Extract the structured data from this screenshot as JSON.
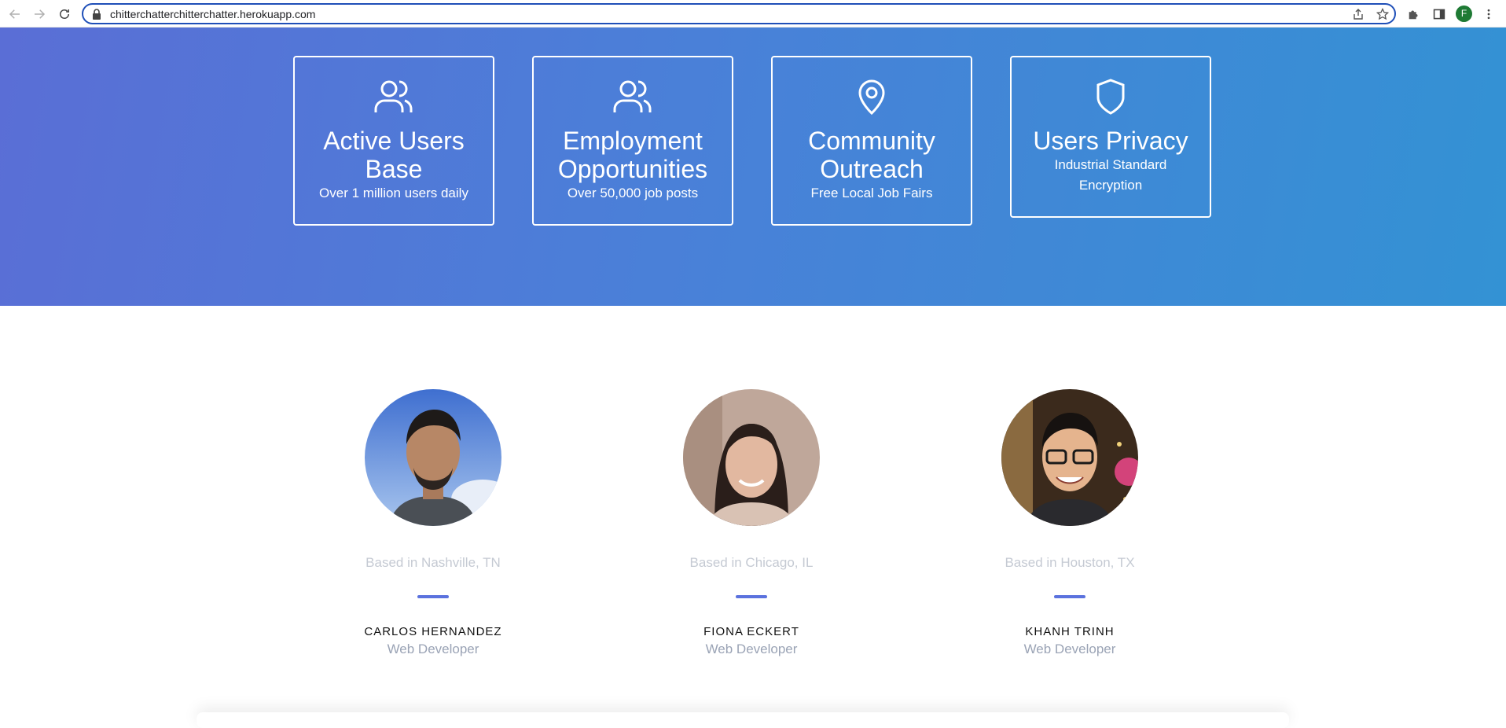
{
  "browser": {
    "url": "chitterchatterchitterchatter.herokuapp.com",
    "profile_initial": "F"
  },
  "features": [
    {
      "icon": "users-icon",
      "title": "Active Users Base",
      "subtitle": "Over 1 million users daily"
    },
    {
      "icon": "users-icon",
      "title": "Employment Opportunities",
      "subtitle": "Over 50,000 job posts"
    },
    {
      "icon": "map-pin-icon",
      "title": "Community Outreach",
      "subtitle": "Free Local Job Fairs"
    },
    {
      "icon": "shield-icon",
      "title": "Users Privacy",
      "subtitle": "Industrial Standard Encryption"
    }
  ],
  "team": [
    {
      "location": "Based in Nashville, TN",
      "name": "CARLOS HERNANDEZ",
      "role": "Web Developer"
    },
    {
      "location": "Based in Chicago, IL",
      "name": "FIONA ECKERT",
      "role": "Web Developer"
    },
    {
      "location": "Based in Houston, TX",
      "name": "KHANH TRINH",
      "role": "Web Developer"
    }
  ],
  "colors": {
    "hero_start": "#5a6ed6",
    "hero_end": "#3392d4",
    "accent_bar": "#5b72de",
    "address_border": "#1f4fb8"
  }
}
